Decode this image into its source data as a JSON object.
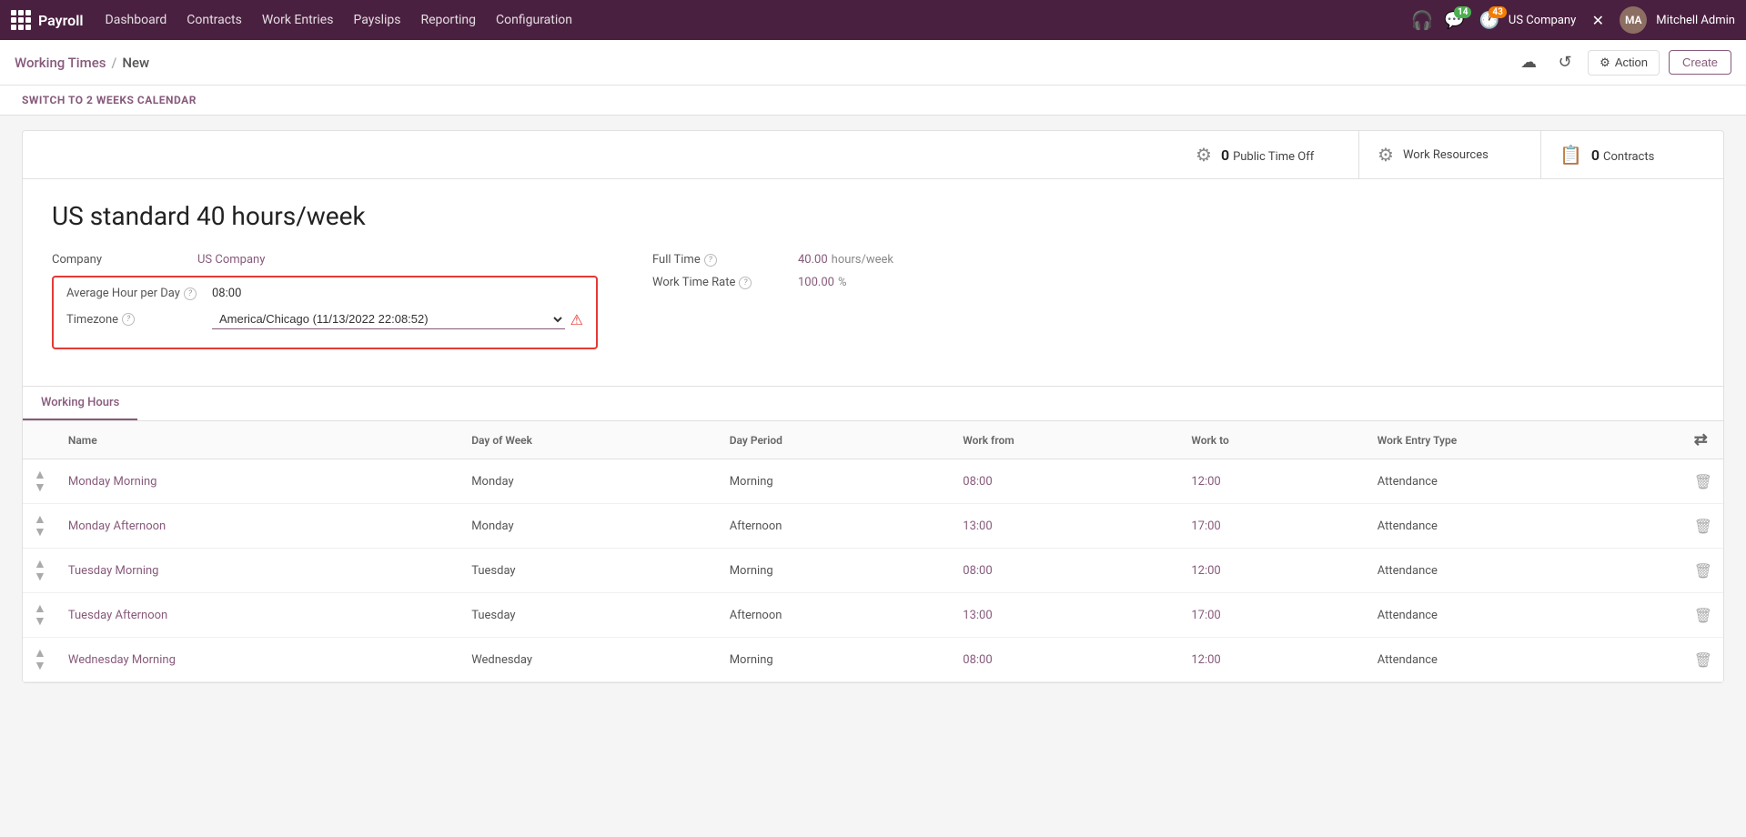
{
  "topnav": {
    "brand": "Payroll",
    "menu_items": [
      "Dashboard",
      "Contracts",
      "Work Entries",
      "Payslips",
      "Reporting",
      "Configuration"
    ],
    "badge_chat": "14",
    "badge_activity": "43",
    "company": "US Company",
    "user": "Mitchell Admin",
    "tools_icon": "⚙"
  },
  "secondary": {
    "breadcrumb_parent": "Working Times",
    "breadcrumb_current": "New",
    "action_label": "Action",
    "create_label": "Create"
  },
  "switch_banner": {
    "label": "SWITCH TO 2 WEEKS CALENDAR"
  },
  "stats": [
    {
      "number": "0",
      "label": "Public Time Off",
      "icon": "⚙"
    },
    {
      "number": "",
      "label": "Work Resources",
      "icon": "⚙"
    },
    {
      "number": "0",
      "label": "Contracts",
      "icon": "📋"
    }
  ],
  "form": {
    "title": "US standard 40 hours/week",
    "company_label": "Company",
    "company_value": "US Company",
    "avg_hour_label": "Average Hour per Day",
    "avg_hour_value": "08:00",
    "timezone_label": "Timezone",
    "timezone_value": "America/Chicago (11/13/2022 22:08:52)",
    "fulltime_label": "Full Time",
    "fulltime_value": "40.00",
    "fulltime_unit": "hours/week",
    "worktime_label": "Work Time Rate",
    "worktime_value": "100.00",
    "worktime_unit": "%"
  },
  "tabs": [
    {
      "label": "Working Hours",
      "active": true
    }
  ],
  "table": {
    "columns": [
      "",
      "Name",
      "Day of Week",
      "Day Period",
      "Work from",
      "Work to",
      "Work Entry Type",
      ""
    ],
    "rows": [
      {
        "name": "Monday Morning",
        "day": "Monday",
        "period": "Morning",
        "from": "08:00",
        "to": "12:00",
        "entry_type": "Attendance"
      },
      {
        "name": "Monday Afternoon",
        "day": "Monday",
        "period": "Afternoon",
        "from": "13:00",
        "to": "17:00",
        "entry_type": "Attendance"
      },
      {
        "name": "Tuesday Morning",
        "day": "Tuesday",
        "period": "Morning",
        "from": "08:00",
        "to": "12:00",
        "entry_type": "Attendance"
      },
      {
        "name": "Tuesday Afternoon",
        "day": "Tuesday",
        "period": "Afternoon",
        "from": "13:00",
        "to": "17:00",
        "entry_type": "Attendance"
      },
      {
        "name": "Wednesday Morning",
        "day": "Wednesday",
        "period": "Morning",
        "from": "08:00",
        "to": "12:00",
        "entry_type": "Attendance"
      }
    ]
  }
}
